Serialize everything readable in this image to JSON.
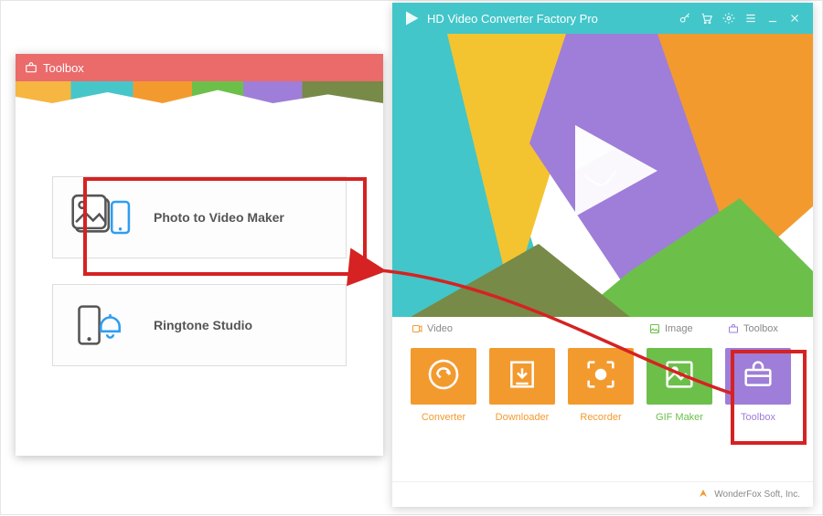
{
  "main": {
    "title": "HD Video Converter Factory Pro",
    "titlebar_icons": {
      "key": "key-icon",
      "cart": "cart-icon",
      "gear": "gear-icon",
      "menu": "menu-icon",
      "minimize": "minimize-icon",
      "close": "close-icon"
    },
    "sections": {
      "video": "Video",
      "image": "Image",
      "toolbox": "Toolbox"
    },
    "tools": {
      "converter": "Converter",
      "downloader": "Downloader",
      "recorder": "Recorder",
      "gif_maker": "GIF Maker",
      "toolbox": "Toolbox"
    },
    "footer": "WonderFox Soft, Inc."
  },
  "toolbox_dialog": {
    "title": "Toolbox",
    "items": {
      "photo_to_video": "Photo to Video Maker",
      "ringtone": "Ringtone Studio"
    }
  }
}
